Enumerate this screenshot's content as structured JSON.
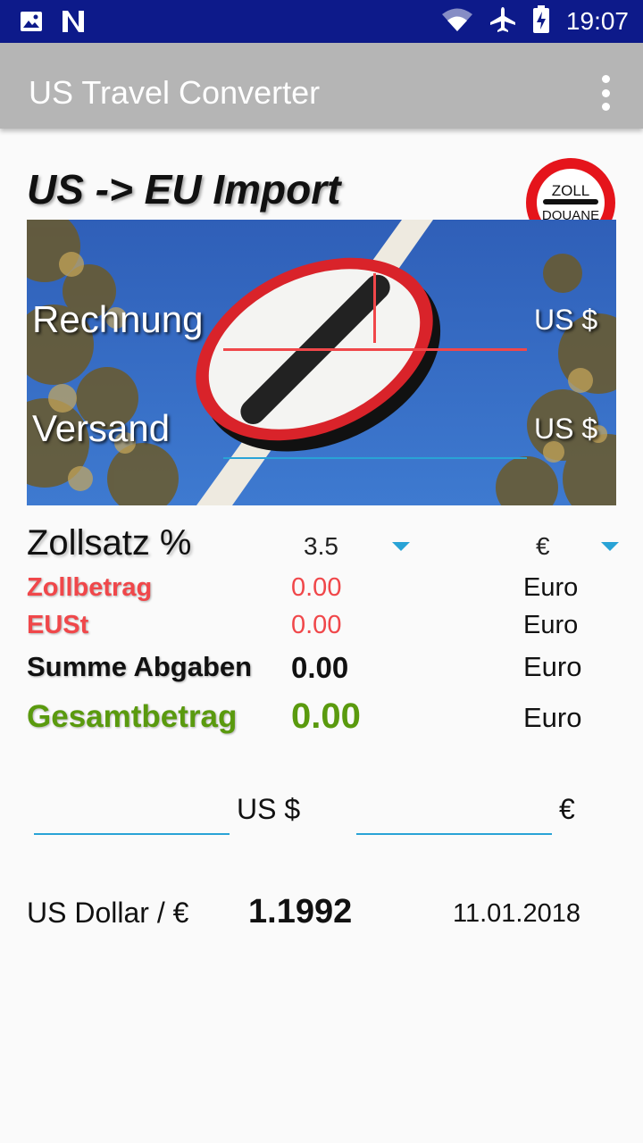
{
  "status_bar": {
    "time": "19:07"
  },
  "appbar": {
    "title": "US Travel Converter"
  },
  "heading": "US -> EU Import",
  "badge": {
    "line1": "ZOLL",
    "line2": "DOUANE"
  },
  "invoice": {
    "label": "Rechnung",
    "currency": "US $"
  },
  "shipping": {
    "label": "Versand",
    "currency": "US $"
  },
  "duty_rate": {
    "label": "Zollsatz %",
    "value": "3.5",
    "currency": "€"
  },
  "results": {
    "duty": {
      "label": "Zollbetrag",
      "value": "0.00",
      "unit": "Euro"
    },
    "vat": {
      "label": "EUSt",
      "value": "0.00",
      "unit": "Euro"
    },
    "sum": {
      "label": "Summe Abgaben",
      "value": "0.00",
      "unit": "Euro"
    },
    "total": {
      "label": "Gesamtbetrag",
      "value": "0.00",
      "unit": "Euro"
    }
  },
  "converter": {
    "usd_label": "US $",
    "eur_label": "€"
  },
  "rate": {
    "label": "US Dollar / €",
    "value": "1.1992",
    "date": "11.01.2018"
  },
  "colors": {
    "red": "#f0474a",
    "green": "#5a9a0e",
    "accent": "#29a3d6",
    "statusbar": "#0d1a8a",
    "appbar": "#b5b5b5"
  }
}
